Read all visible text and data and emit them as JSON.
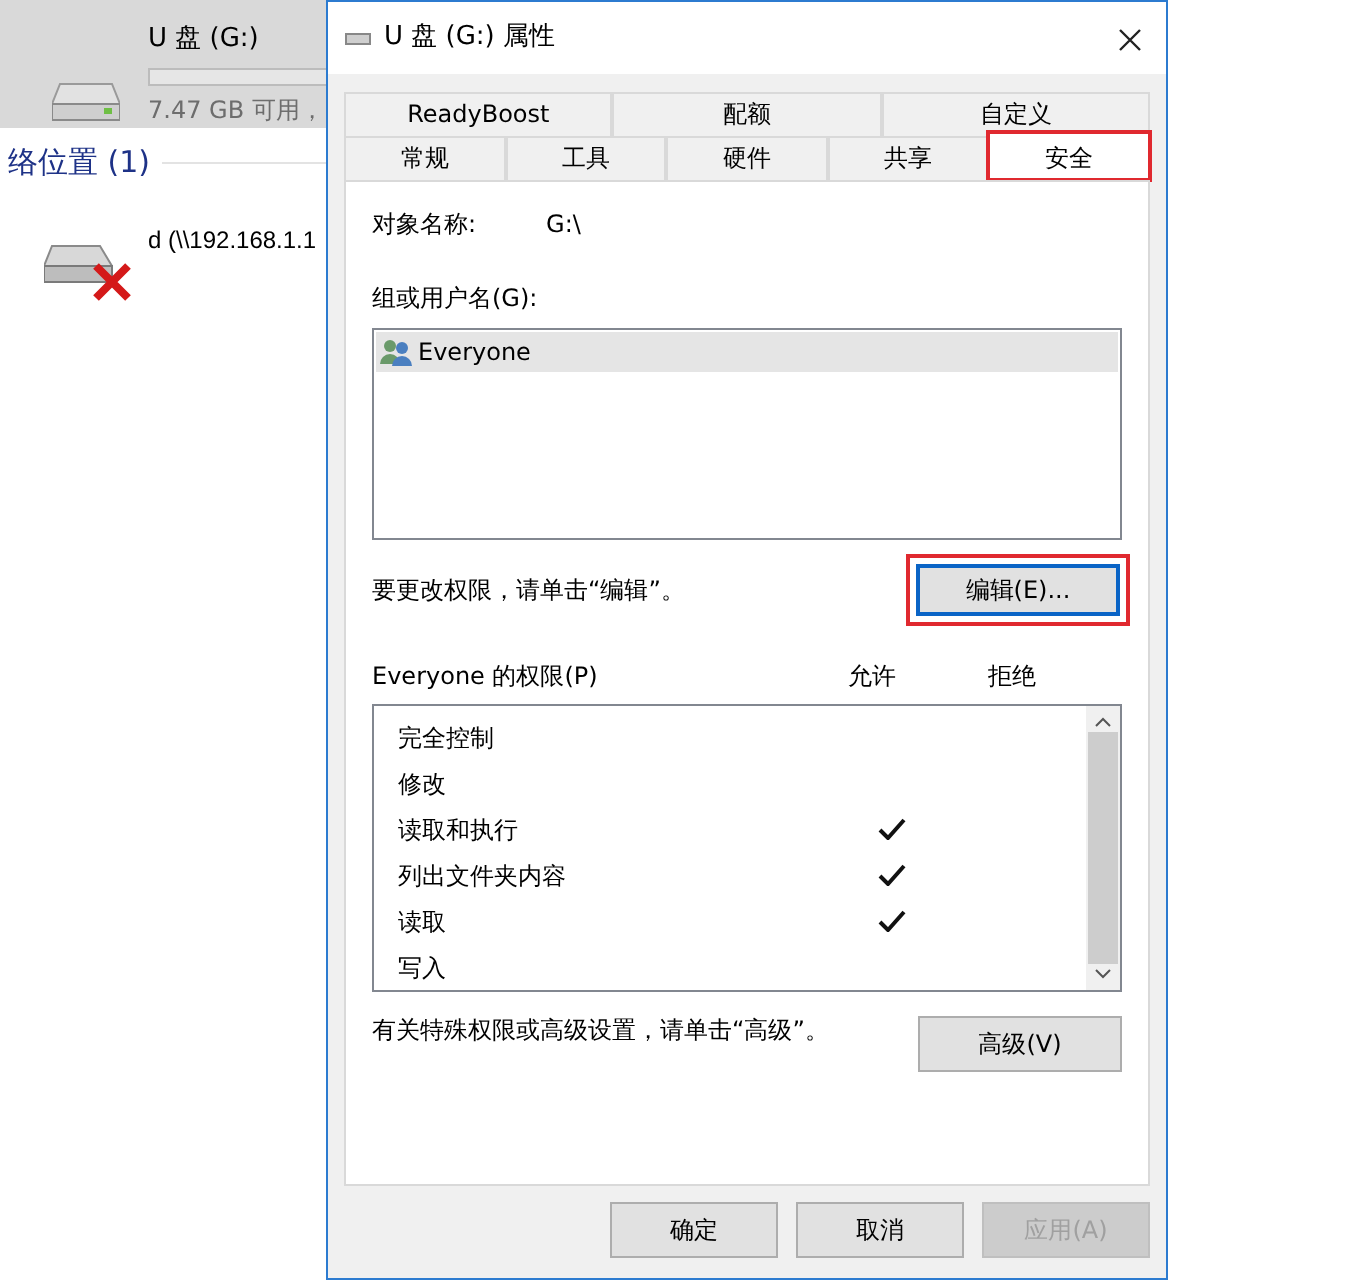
{
  "explorer": {
    "drive": {
      "name": "U 盘 (G:)",
      "free": "7.47 GB 可用，",
      "selected": true
    },
    "section": "络位置 (1)",
    "network_drive": {
      "name": "d (\\\\192.168.1.1",
      "disconnected": true
    }
  },
  "dialog": {
    "title": "U 盘 (G:) 属性",
    "tab_rows": [
      [
        {
          "label": "ReadyBoost",
          "selected": false,
          "highlighted": false
        },
        {
          "label": "配额",
          "selected": false,
          "highlighted": false
        },
        {
          "label": "自定义",
          "selected": false,
          "highlighted": false
        }
      ],
      [
        {
          "label": "常规",
          "selected": false,
          "highlighted": false
        },
        {
          "label": "工具",
          "selected": false,
          "highlighted": false
        },
        {
          "label": "硬件",
          "selected": false,
          "highlighted": false
        },
        {
          "label": "共享",
          "selected": false,
          "highlighted": false
        },
        {
          "label": "安全",
          "selected": true,
          "highlighted": true
        }
      ]
    ],
    "object_label": "对象名称:",
    "object_value": "G:\\",
    "groups_label": "组或用户名(G):",
    "groups": [
      {
        "name": "Everyone",
        "selected": true
      }
    ],
    "edit_hint": "要更改权限，请单击“编辑”。",
    "edit_button": {
      "label": "编辑(E)...",
      "highlighted": true
    },
    "permissions_label": "Everyone 的权限(P)",
    "allow_label": "允许",
    "deny_label": "拒绝",
    "permissions": [
      {
        "name": "完全控制",
        "allow": false,
        "deny": false
      },
      {
        "name": "修改",
        "allow": false,
        "deny": false
      },
      {
        "name": "读取和执行",
        "allow": true,
        "deny": false
      },
      {
        "name": "列出文件夹内容",
        "allow": true,
        "deny": false
      },
      {
        "name": "读取",
        "allow": true,
        "deny": false
      },
      {
        "name": "写入",
        "allow": false,
        "deny": false
      }
    ],
    "advanced_hint": "有关特殊权限或高级设置，请单击“高级”。",
    "advanced_button": {
      "label": "高级(V)",
      "disabled": false
    },
    "buttons": [
      {
        "label": "确定",
        "disabled": false
      },
      {
        "label": "取消",
        "disabled": false
      },
      {
        "label": "应用(A)",
        "disabled": true
      }
    ]
  }
}
